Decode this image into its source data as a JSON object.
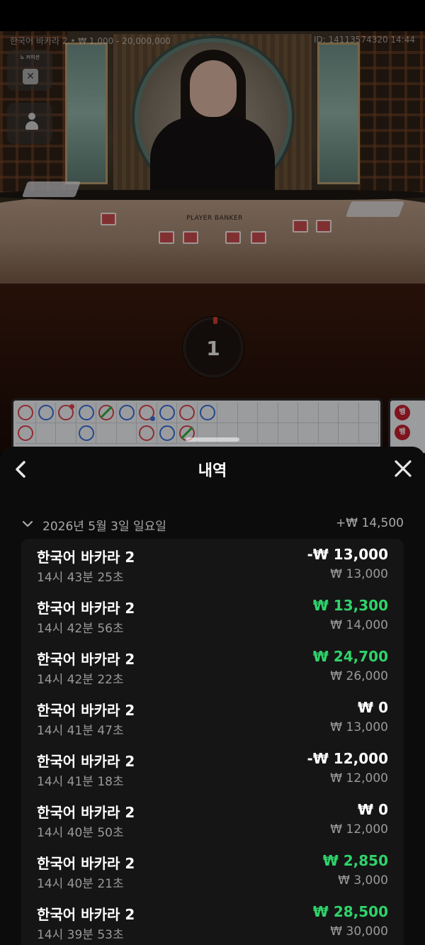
{
  "video": {
    "table_title": "한국어 바카라 2 • ₩ 1,000 - 20,000,000",
    "round_id": "ID: 14113574320 14:44",
    "mini_label": "노 커미션",
    "felt_label": "PLAYER    BANKER",
    "countdown": "1",
    "road_banker_label": "뱅"
  },
  "sheet": {
    "title": "내역",
    "date_group": {
      "date": "2026년 5월 3일 일요일",
      "total": "+₩ 14,500"
    },
    "rows": [
      {
        "game": "한국어 바카라 2",
        "time": "14시 43분 25초",
        "result": "-₩ 13,000",
        "stake": "₩ 13,000",
        "kind": "neg"
      },
      {
        "game": "한국어 바카라 2",
        "time": "14시 42분 56초",
        "result": "₩ 13,300",
        "stake": "₩ 14,000",
        "kind": "pos"
      },
      {
        "game": "한국어 바카라 2",
        "time": "14시 42분 22초",
        "result": "₩ 24,700",
        "stake": "₩ 26,000",
        "kind": "pos"
      },
      {
        "game": "한국어 바카라 2",
        "time": "14시 41분 47초",
        "result": "₩ 0",
        "stake": "₩ 13,000",
        "kind": "zero"
      },
      {
        "game": "한국어 바카라 2",
        "time": "14시 41분 18초",
        "result": "-₩ 12,000",
        "stake": "₩ 12,000",
        "kind": "neg"
      },
      {
        "game": "한국어 바카라 2",
        "time": "14시 40분 50초",
        "result": "₩ 0",
        "stake": "₩ 12,000",
        "kind": "zero"
      },
      {
        "game": "한국어 바카라 2",
        "time": "14시 40분 21초",
        "result": "₩ 2,850",
        "stake": "₩ 3,000",
        "kind": "pos"
      },
      {
        "game": "한국어 바카라 2",
        "time": "14시 39분 53초",
        "result": "₩ 28,500",
        "stake": "₩ 30,000",
        "kind": "pos"
      }
    ]
  },
  "colors": {
    "win_green": "#2fd36b",
    "banker_red": "#d9444c",
    "player_blue": "#3a6fd8",
    "tie_green": "#2fae3f"
  },
  "icons": [
    "close-icon",
    "user-icon",
    "back-chevron-icon",
    "close-x-icon",
    "chevron-down-icon"
  ]
}
